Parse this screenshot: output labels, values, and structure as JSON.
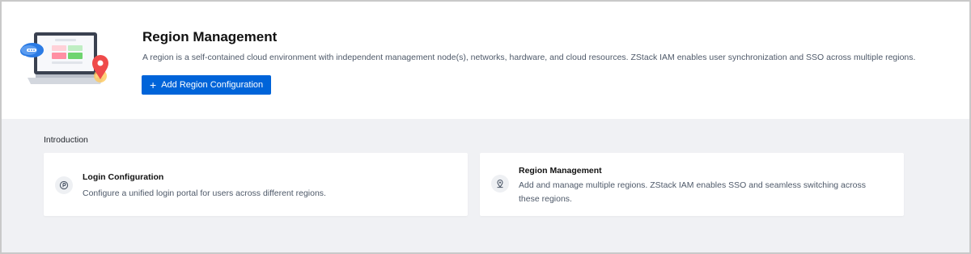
{
  "header": {
    "illustration": "cloud-laptop-location-illustration",
    "title": "Region Management",
    "description": "A region is a self-contained cloud environment with independent management node(s), networks, hardware, and cloud resources. ZStack IAM enables user synchronization and SSO across multiple regions.",
    "add_button_label": "Add Region Configuration",
    "add_button_icon": "plus-icon",
    "accent_color": "#0064d9"
  },
  "intro": {
    "title": "Introduction",
    "cards": [
      {
        "icon": "login-icon",
        "title": "Login Configuration",
        "text": "Configure a unified login portal for users across different regions."
      },
      {
        "icon": "location-pin-icon",
        "title": "Region Management",
        "text": "Add and manage multiple regions. ZStack IAM enables SSO and seamless switching across these regions."
      }
    ]
  }
}
